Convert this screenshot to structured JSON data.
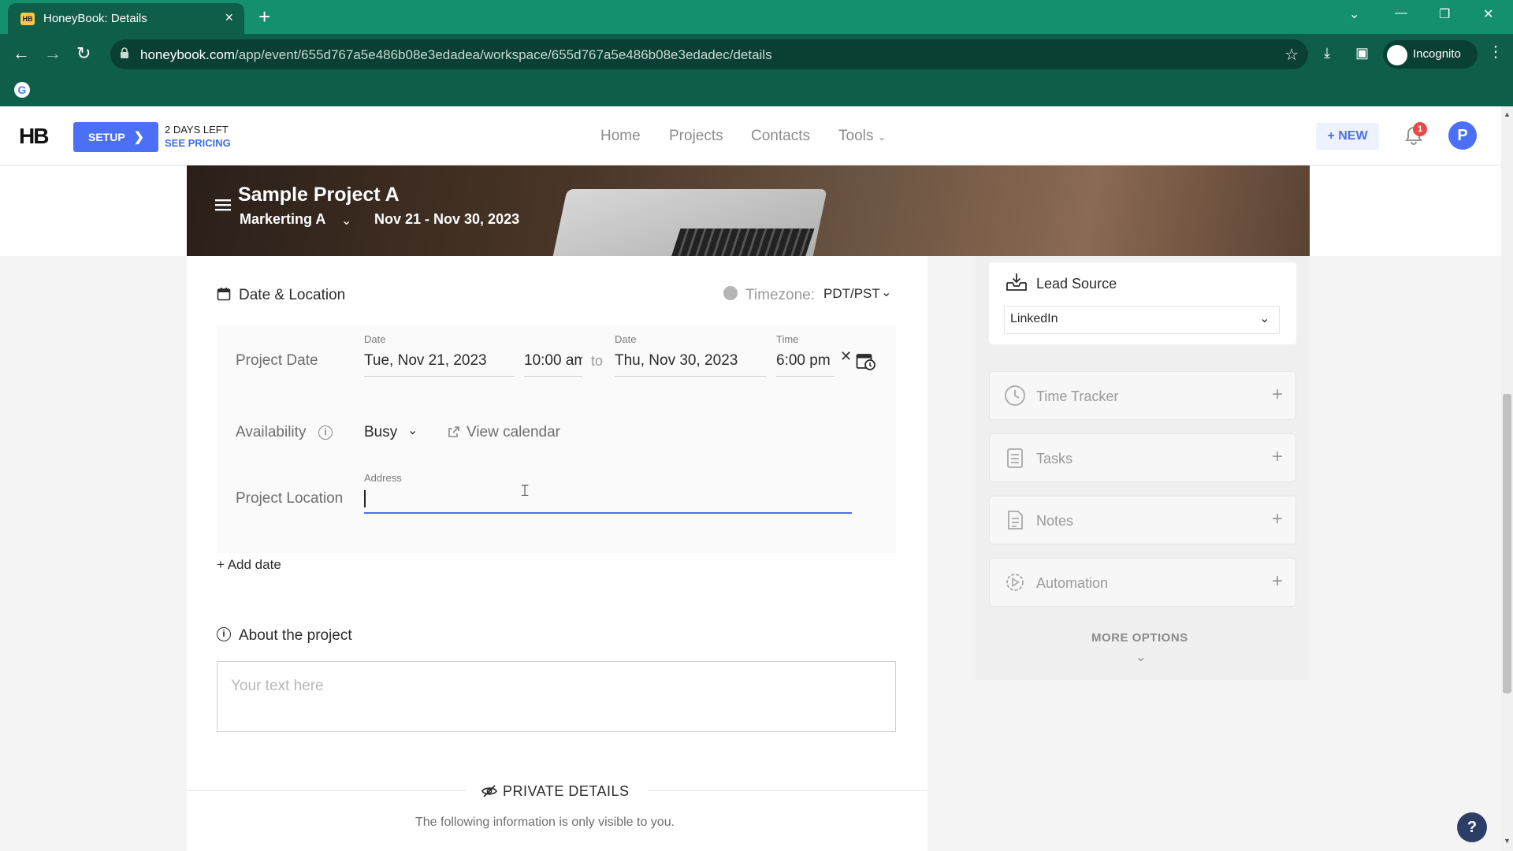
{
  "browser": {
    "tab_title": "HoneyBook: Details",
    "favicon_text": "HB",
    "url_host": "honeybook.com",
    "url_path": "/app/event/655d767a5e486b08e3edadea/workspace/655d767a5e486b08e3edadec/details",
    "incognito_label": "Incognito"
  },
  "header": {
    "logo": "HB",
    "setup_label": "SETUP",
    "days_left": "2 DAYS LEFT",
    "see_pricing": "SEE PRICING",
    "nav": [
      "Home",
      "Projects",
      "Contacts",
      "Tools"
    ],
    "new_label": "+ NEW",
    "notification_count": "1",
    "avatar_initial": "P"
  },
  "project": {
    "title": "Sample Project A",
    "company": "Markerting A",
    "dates": "Nov 21 - Nov 30, 2023"
  },
  "date_location": {
    "section_title": "Date & Location",
    "timezone_label": "Timezone:",
    "timezone_value": "PDT/PST",
    "project_date_label": "Project Date",
    "start_date_label": "Date",
    "start_date": "Tue, Nov 21, 2023",
    "start_time": "10:00 am",
    "to_label": "to",
    "end_date_label": "Date",
    "end_date": "Thu, Nov 30, 2023",
    "end_time_label": "Time",
    "end_time": "6:00 pm",
    "availability_label": "Availability",
    "availability_value": "Busy",
    "view_calendar": "View calendar",
    "location_label": "Project Location",
    "address_label": "Address",
    "address_value": "",
    "add_date": "+ Add date"
  },
  "about": {
    "section_title": "About the project",
    "placeholder": "Your text here"
  },
  "private": {
    "title": "PRIVATE DETAILS",
    "note": "The following information is only visible to you."
  },
  "sidebar": {
    "lead_source_title": "Lead Source",
    "lead_source_value": "LinkedIn",
    "tools": [
      {
        "label": "Time Tracker"
      },
      {
        "label": "Tasks"
      },
      {
        "label": "Notes"
      },
      {
        "label": "Automation"
      }
    ],
    "more_options": "MORE OPTIONS"
  },
  "colors": {
    "accent": "#4c70f5",
    "chrome_green": "#14906f",
    "badge_red": "#e84a4a"
  }
}
